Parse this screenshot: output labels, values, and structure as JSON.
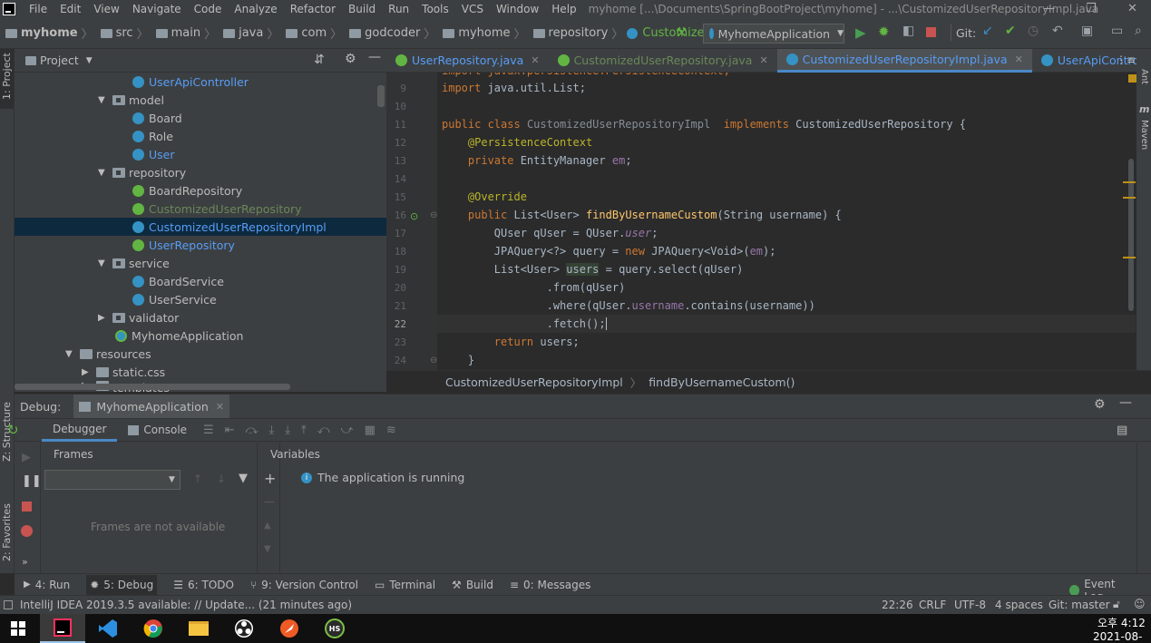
{
  "menubar": {
    "items": [
      "File",
      "Edit",
      "View",
      "Navigate",
      "Code",
      "Analyze",
      "Refactor",
      "Build",
      "Run",
      "Tools",
      "VCS",
      "Window",
      "Help"
    ],
    "title": "myhome [...\\Documents\\SpringBootProject\\myhome] - ...\\CustomizedUserRepositoryImpl.java"
  },
  "navbar": {
    "crumbs": [
      "myhome",
      "src",
      "main",
      "java",
      "com",
      "godcoder",
      "myhome",
      "repository",
      "CustomizedUserRepositoryImpl"
    ],
    "run_config": "MyhomeApplication",
    "git_label": "Git:"
  },
  "leftstrip": {
    "project": "1: Project",
    "structure": "Z: Structure",
    "favorites": "2: Favorites"
  },
  "rightstrip": {
    "ant": "Ant",
    "maven": "Maven"
  },
  "project": {
    "header": "Project",
    "rows": [
      {
        "label": "UserApiController",
        "kind": "class"
      },
      {
        "label": "model",
        "kind": "package"
      },
      {
        "label": "Board",
        "kind": "class"
      },
      {
        "label": "Role",
        "kind": "class"
      },
      {
        "label": "User",
        "kind": "class"
      },
      {
        "label": "repository",
        "kind": "package"
      },
      {
        "label": "BoardRepository",
        "kind": "interface"
      },
      {
        "label": "CustomizedUserRepository",
        "kind": "interface"
      },
      {
        "label": "CustomizedUserRepositoryImpl",
        "kind": "class"
      },
      {
        "label": "UserRepository",
        "kind": "interface"
      },
      {
        "label": "service",
        "kind": "package"
      },
      {
        "label": "BoardService",
        "kind": "class"
      },
      {
        "label": "UserService",
        "kind": "class"
      },
      {
        "label": "validator",
        "kind": "package"
      },
      {
        "label": "MyhomeApplication",
        "kind": "app"
      },
      {
        "label": "resources",
        "kind": "folder"
      },
      {
        "label": "static.css",
        "kind": "folder"
      },
      {
        "label": "templates",
        "kind": "folder"
      }
    ]
  },
  "editor": {
    "tabs": [
      "UserRepository.java",
      "CustomizedUserRepository.java",
      "CustomizedUserRepositoryImpl.java",
      "UserApiController.java"
    ],
    "line_numbers": [
      "9",
      "10",
      "11",
      "12",
      "13",
      "14",
      "15",
      "16",
      "17",
      "18",
      "19",
      "20",
      "21",
      "22",
      "23",
      "24"
    ],
    "breadcrumb": [
      "CustomizedUserRepositoryImpl",
      "findByUsernameCustom()"
    ]
  },
  "debug": {
    "label": "Debug:",
    "session": "MyhomeApplication",
    "tabs": [
      "Debugger",
      "Console"
    ],
    "frames_title": "Frames",
    "variables_title": "Variables",
    "frames_empty": "Frames are not available",
    "running_msg": "The application is running"
  },
  "toolwindows": {
    "run": "4: Run",
    "debug": "5: Debug",
    "todo": "6: TODO",
    "vcs": "9: Version Control",
    "terminal": "Terminal",
    "build": "Build",
    "messages": "0: Messages",
    "event_log": "Event Log"
  },
  "status": {
    "message": "IntelliJ IDEA 2019.3.5 available: // Update... (21 minutes ago)",
    "position": "22:26",
    "line_sep": "CRLF",
    "encoding": "UTF-8",
    "indent": "4 spaces",
    "git": "Git: master"
  },
  "taskbar": {
    "time": "오후 4:12",
    "date": "2021-08-16",
    "hs_label": "HS"
  }
}
